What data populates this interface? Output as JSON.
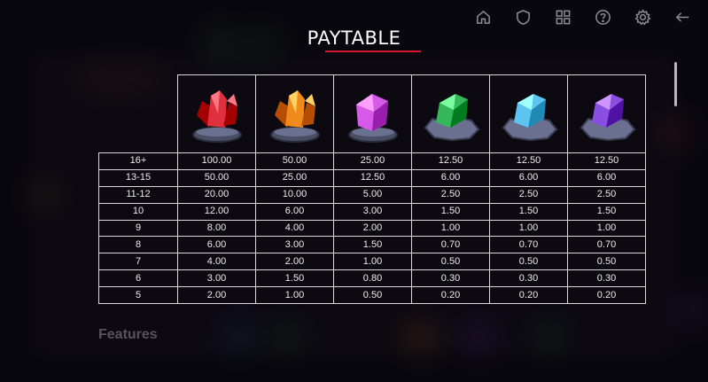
{
  "header": {
    "title": "PAYTABLE",
    "icons": [
      "home-icon",
      "shield-icon",
      "grid-icon",
      "help-icon",
      "settings-icon",
      "back-arrow-icon"
    ]
  },
  "paytable": {
    "symbols": [
      {
        "name": "red-crystal-symbol",
        "color": "#e0303e"
      },
      {
        "name": "orange-crystal-symbol",
        "color": "#f18a1c"
      },
      {
        "name": "pink-crystal-symbol",
        "color": "#d55ae8"
      },
      {
        "name": "green-crystal-symbol",
        "color": "#34b85a"
      },
      {
        "name": "blue-crystal-symbol",
        "color": "#5cc4f0"
      },
      {
        "name": "purple-crystal-symbol",
        "color": "#8a4ee0"
      }
    ],
    "rows": [
      {
        "count": "16+",
        "values": [
          "100.00",
          "50.00",
          "25.00",
          "12.50",
          "12.50",
          "12.50"
        ]
      },
      {
        "count": "13-15",
        "values": [
          "50.00",
          "25.00",
          "12.50",
          "6.00",
          "6.00",
          "6.00"
        ]
      },
      {
        "count": "11-12",
        "values": [
          "20.00",
          "10.00",
          "5.00",
          "2.50",
          "2.50",
          "2.50"
        ]
      },
      {
        "count": "10",
        "values": [
          "12.00",
          "6.00",
          "3.00",
          "1.50",
          "1.50",
          "1.50"
        ]
      },
      {
        "count": "9",
        "values": [
          "8.00",
          "4.00",
          "2.00",
          "1.00",
          "1.00",
          "1.00"
        ]
      },
      {
        "count": "8",
        "values": [
          "6.00",
          "3.00",
          "1.50",
          "0.70",
          "0.70",
          "0.70"
        ]
      },
      {
        "count": "7",
        "values": [
          "4.00",
          "2.00",
          "1.00",
          "0.50",
          "0.50",
          "0.50"
        ]
      },
      {
        "count": "6",
        "values": [
          "3.00",
          "1.50",
          "0.80",
          "0.30",
          "0.30",
          "0.30"
        ]
      },
      {
        "count": "5",
        "values": [
          "2.00",
          "1.00",
          "0.50",
          "0.20",
          "0.20",
          "0.20"
        ]
      }
    ]
  },
  "features_heading": "Features",
  "colors": {
    "accent": "#d5152a",
    "background": "#0c0a10",
    "border": "#d9d9d9"
  }
}
